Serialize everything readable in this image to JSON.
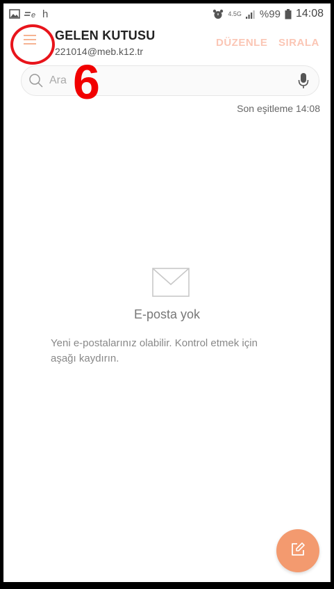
{
  "status_bar": {
    "left_text": "h",
    "network_label": "4.5G",
    "battery": "%99",
    "time": "14:08"
  },
  "header": {
    "title": "GELEN KUTUSU",
    "account": "221014@meb.k12.tr",
    "edit_label": "DÜZENLE",
    "sort_label": "SIRALA"
  },
  "search": {
    "placeholder": "Ara"
  },
  "annotation": {
    "number": "6"
  },
  "sync": {
    "text": "Son eşitleme  14:08"
  },
  "empty_state": {
    "title": "E-posta yok",
    "description": "Yeni e-postalarınız olabilir. Kontrol etmek için aşağı kaydırın."
  },
  "colors": {
    "accent": "#f39a6f",
    "action_text": "#fbc6b5",
    "annotation": "#f10000"
  },
  "icons": {
    "menu": "hamburger-menu-icon",
    "search": "search-icon",
    "mic": "microphone-icon",
    "empty": "envelope-icon",
    "compose": "compose-icon"
  }
}
